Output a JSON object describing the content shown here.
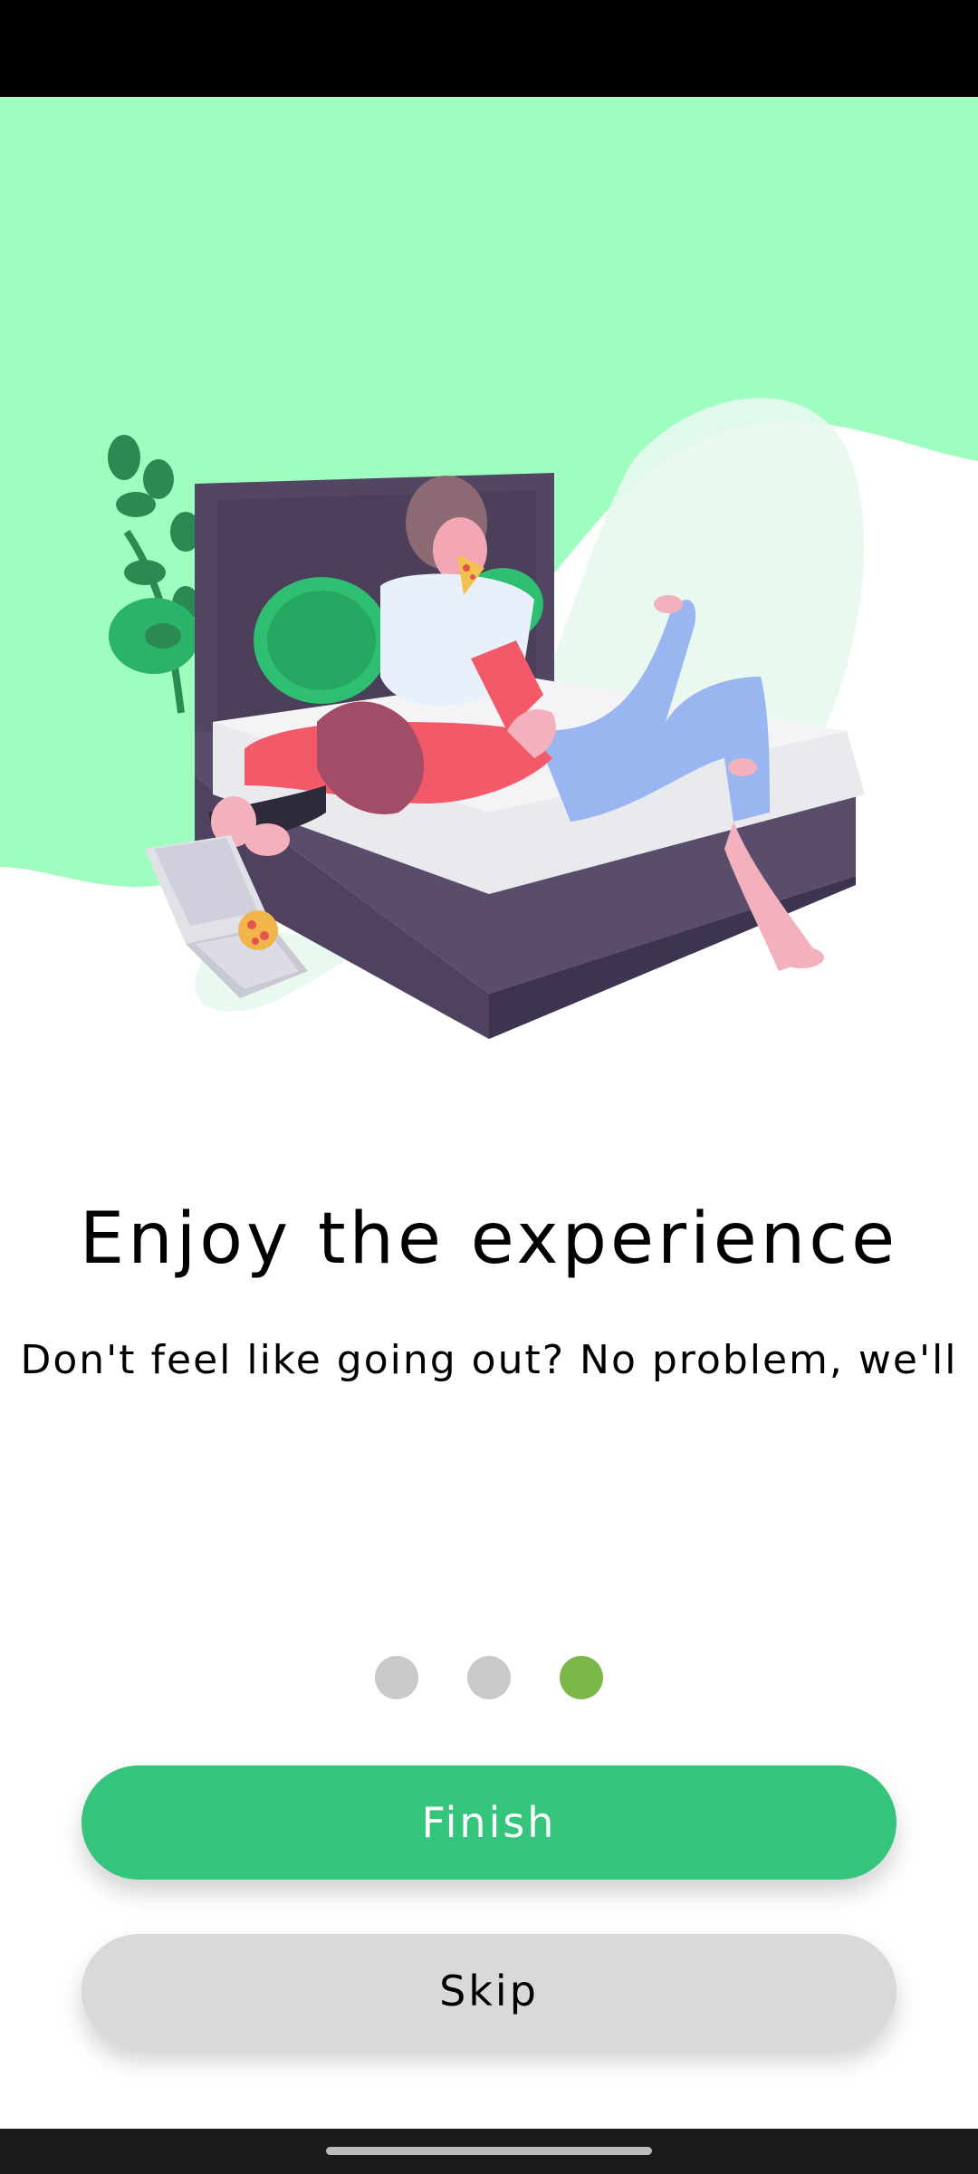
{
  "onboarding": {
    "title": "Enjoy the experience",
    "subtitle": "Don't feel like going out? No problem, we'll",
    "illustration": "couple-on-bed-eating-pizza-illustration",
    "page_indicator": {
      "total": 3,
      "current": 3
    }
  },
  "actions": {
    "finish_label": "Finish",
    "skip_label": "Skip"
  },
  "colors": {
    "primary": "#34c47c",
    "accent_dot": "#7ab648",
    "inactive_dot": "#cacaca",
    "hero_background": "#a0fdc0",
    "secondary_button": "#d9d9d9"
  }
}
